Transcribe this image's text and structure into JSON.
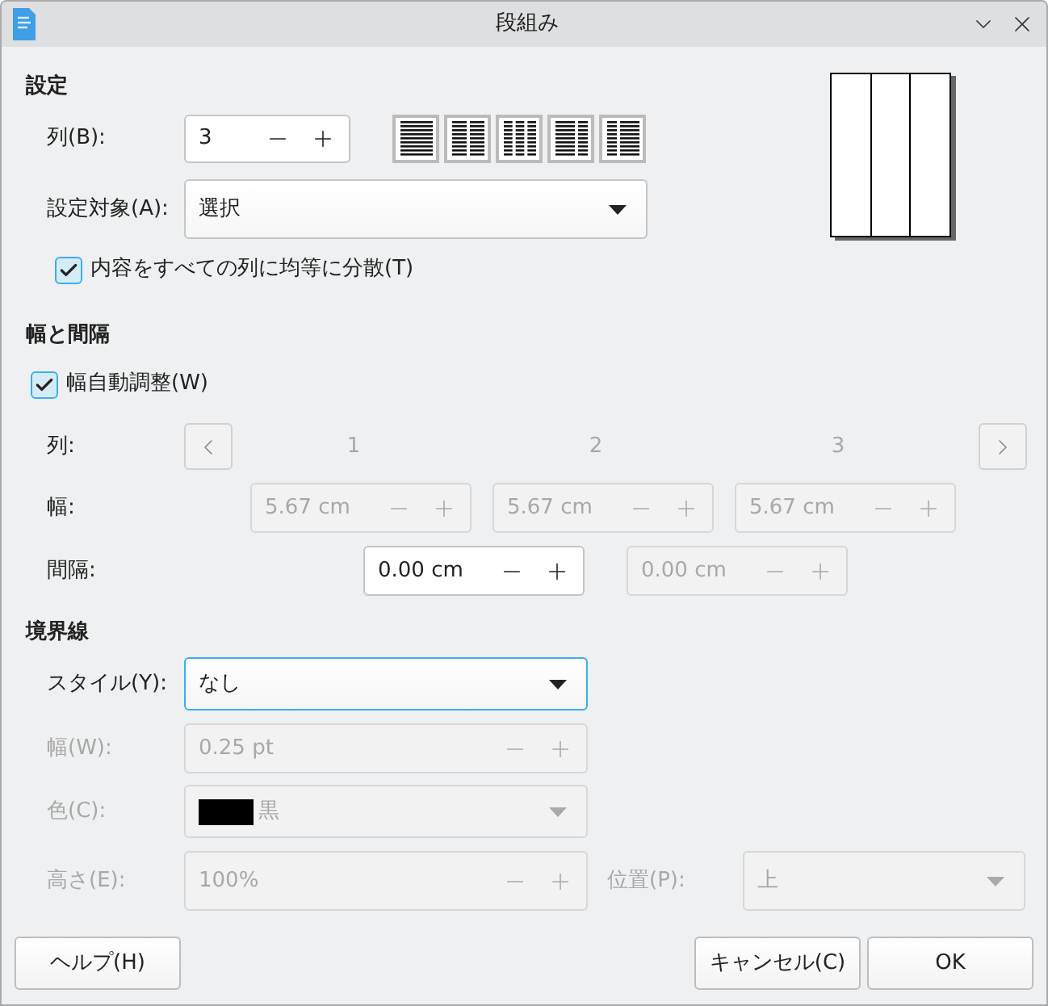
{
  "window": {
    "title": "段組み"
  },
  "settings": {
    "heading": "設定",
    "columns": {
      "label": "列(B):",
      "value": "3"
    },
    "presets": [
      {
        "kind": "one"
      },
      {
        "kind": "two"
      },
      {
        "kind": "three"
      },
      {
        "kind": "left"
      },
      {
        "kind": "right"
      }
    ],
    "apply_to": {
      "label": "設定対象(A):",
      "value": "選択"
    },
    "distribute": {
      "label": "内容をすべての列に均等に分散(T)",
      "checked": true
    }
  },
  "width_spacing": {
    "heading": "幅と間隔",
    "autowidth": {
      "label": "幅自動調整(W)",
      "checked": true
    },
    "column_label": "列:",
    "column_numbers": [
      "1",
      "2",
      "3"
    ],
    "width_label": "幅:",
    "widths": [
      {
        "value": "5.67 cm",
        "disabled": true
      },
      {
        "value": "5.67 cm",
        "disabled": true
      },
      {
        "value": "5.67 cm",
        "disabled": true
      }
    ],
    "spacing_label": "間隔:",
    "spacings": [
      {
        "value": "0.00 cm",
        "disabled": false
      },
      {
        "value": "0.00 cm",
        "disabled": true
      }
    ]
  },
  "separator": {
    "heading": "境界線",
    "style": {
      "label": "スタイル(Y):",
      "value": "なし",
      "focused": true
    },
    "width": {
      "label": "幅(W):",
      "value": "0.25 pt",
      "disabled": true
    },
    "color": {
      "label": "色(C):",
      "value": "黒",
      "disabled": true
    },
    "height": {
      "label": "高さ(E):",
      "value": "100%",
      "disabled": true
    },
    "position": {
      "label": "位置(P):",
      "value": "上",
      "disabled": true
    }
  },
  "buttons": [
    {
      "label": "ヘルプ(H)",
      "kind": "help"
    },
    {
      "label": "キャンセル(C)",
      "kind": "cancel"
    },
    {
      "label": "OK",
      "kind": "ok"
    }
  ]
}
